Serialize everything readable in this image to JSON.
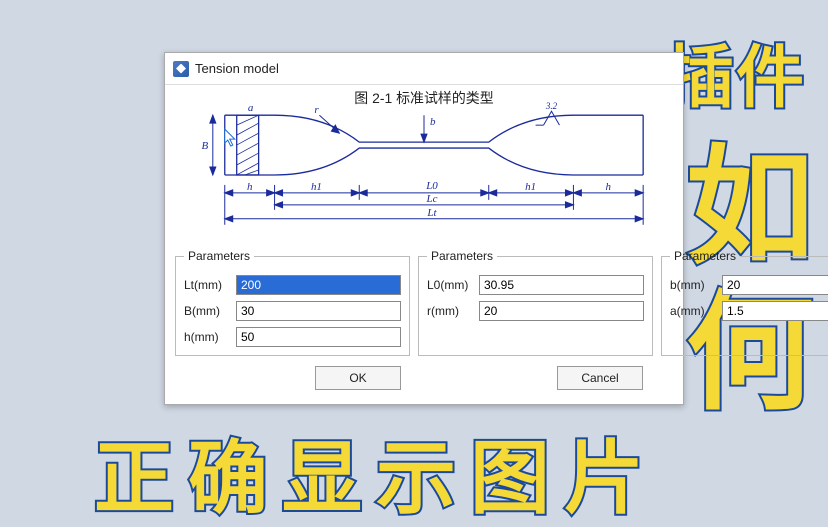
{
  "window": {
    "title": "Tension model"
  },
  "diagram": {
    "title": "图 2-1 标准试样的类型",
    "labels": {
      "B": "B",
      "a": "a",
      "r": "r",
      "b": "b",
      "s32": "3.2",
      "h_left": "h",
      "h1_left": "h1",
      "L0": "L0",
      "Lc": "Lc",
      "Lt": "Lt",
      "h1_right": "h1",
      "h_right": "h"
    }
  },
  "groups": {
    "g1": {
      "legend": "Parameters",
      "fields": [
        {
          "label": "Lt(mm)",
          "value": "200",
          "selected": true
        },
        {
          "label": "B(mm)",
          "value": "30"
        },
        {
          "label": "h(mm)",
          "value": "50"
        }
      ]
    },
    "g2": {
      "legend": "Parameters",
      "fields": [
        {
          "label": "L0(mm)",
          "value": "30.95"
        },
        {
          "label": "r(mm)",
          "value": "20"
        }
      ]
    },
    "g3": {
      "legend": "Parameters",
      "fields": [
        {
          "label": "b(mm)",
          "value": "20"
        },
        {
          "label": "a(mm)",
          "value": "1.5"
        }
      ]
    }
  },
  "buttons": {
    "ok": "OK",
    "cancel": "Cancel"
  },
  "overlay": {
    "plugin": "插件",
    "ru": "如",
    "he": "何",
    "bottom": "正确显示图片"
  }
}
